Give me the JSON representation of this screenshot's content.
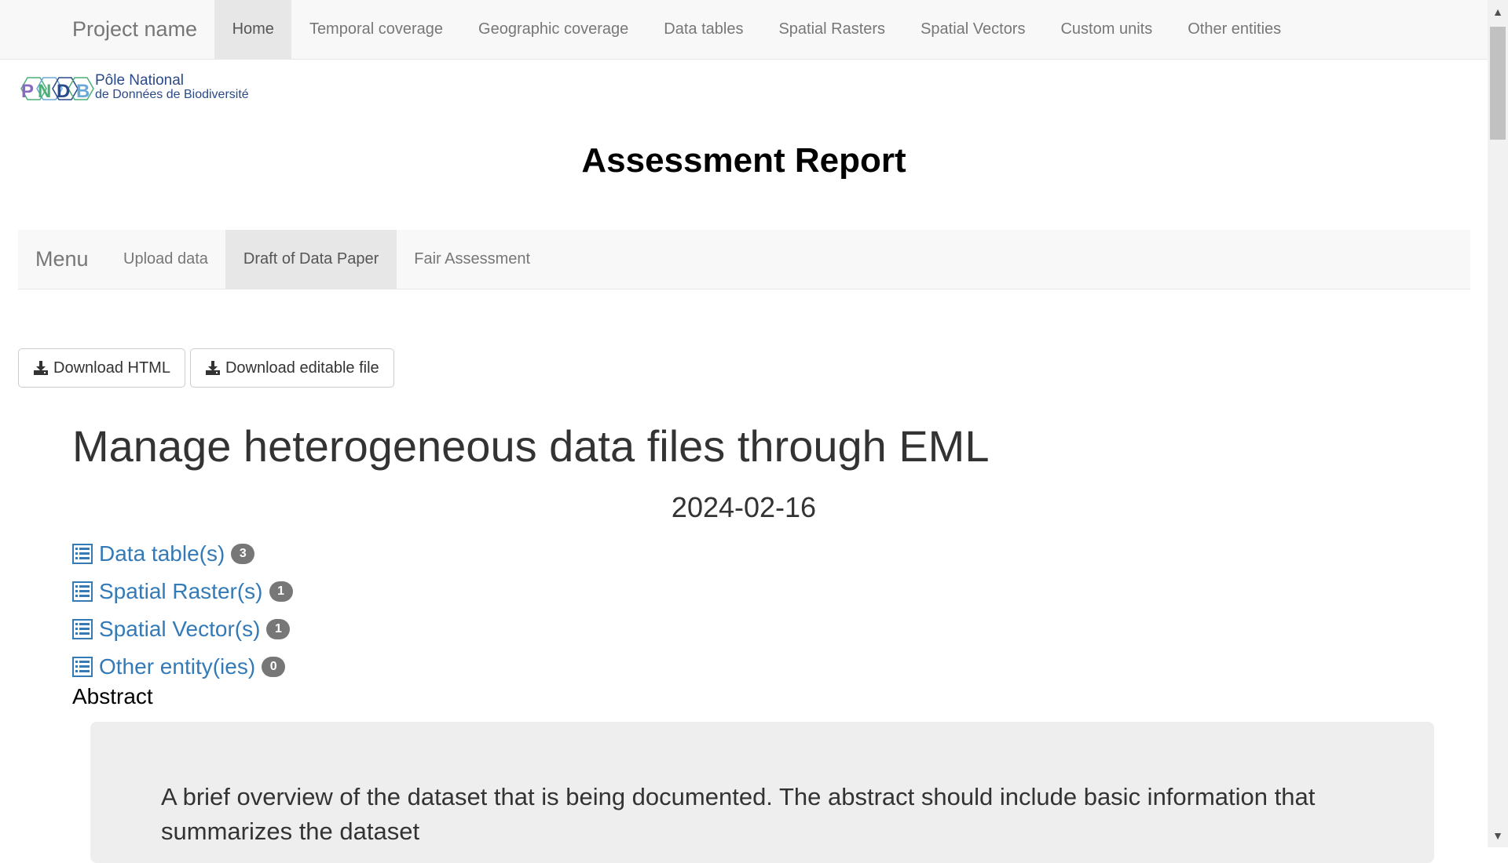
{
  "navbar": {
    "brand": "Project name",
    "items": [
      {
        "label": "Home",
        "active": true
      },
      {
        "label": "Temporal coverage",
        "active": false
      },
      {
        "label": "Geographic coverage",
        "active": false
      },
      {
        "label": "Data tables",
        "active": false
      },
      {
        "label": "Spatial Rasters",
        "active": false
      },
      {
        "label": "Spatial Vectors",
        "active": false
      },
      {
        "label": "Custom units",
        "active": false
      },
      {
        "label": "Other entities",
        "active": false
      }
    ]
  },
  "logo": {
    "letters": "PNDB",
    "line1": "Pôle National",
    "line2": "de Données de Biodiversité"
  },
  "report_title": "Assessment Report",
  "menu": {
    "brand": "Menu",
    "items": [
      {
        "label": "Upload data",
        "active": false
      },
      {
        "label": "Draft of Data Paper",
        "active": true
      },
      {
        "label": "Fair Assessment",
        "active": false
      }
    ]
  },
  "buttons": {
    "download_html": "Download HTML",
    "download_editable": "Download editable file",
    "icon": "download-icon"
  },
  "paper": {
    "title": "Manage heterogeneous data files through EML",
    "date": "2024-02-16"
  },
  "entities": [
    {
      "label": "Data table(s)",
      "count": "3",
      "icon": "list-icon"
    },
    {
      "label": "Spatial Raster(s)",
      "count": "1",
      "icon": "list-icon"
    },
    {
      "label": "Spatial Vector(s)",
      "count": "1",
      "icon": "list-icon"
    },
    {
      "label": "Other entity(ies)",
      "count": "0",
      "icon": "list-icon"
    }
  ],
  "abstract": {
    "label": "Abstract",
    "text": "A brief overview of the dataset that is being documented. The abstract should include basic information that summarizes the dataset"
  },
  "colors": {
    "link": "#337ab7",
    "badge": "#777777",
    "navbar_bg": "#f8f8f8",
    "active_nav": "#e7e7e7"
  }
}
